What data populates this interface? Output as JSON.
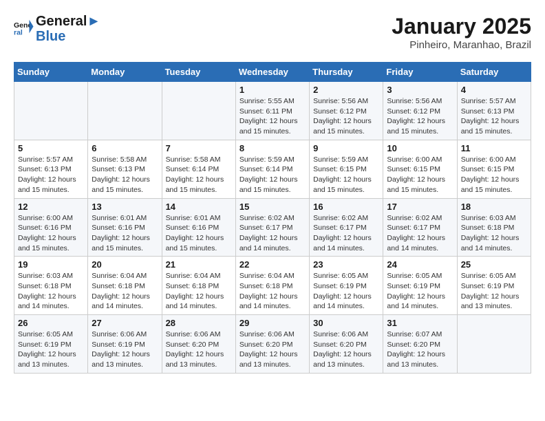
{
  "header": {
    "logo_line1": "General",
    "logo_line2": "Blue",
    "month": "January 2025",
    "location": "Pinheiro, Maranhao, Brazil"
  },
  "weekdays": [
    "Sunday",
    "Monday",
    "Tuesday",
    "Wednesday",
    "Thursday",
    "Friday",
    "Saturday"
  ],
  "weeks": [
    [
      {
        "day": "",
        "detail": ""
      },
      {
        "day": "",
        "detail": ""
      },
      {
        "day": "",
        "detail": ""
      },
      {
        "day": "1",
        "detail": "Sunrise: 5:55 AM\nSunset: 6:11 PM\nDaylight: 12 hours\nand 15 minutes."
      },
      {
        "day": "2",
        "detail": "Sunrise: 5:56 AM\nSunset: 6:12 PM\nDaylight: 12 hours\nand 15 minutes."
      },
      {
        "day": "3",
        "detail": "Sunrise: 5:56 AM\nSunset: 6:12 PM\nDaylight: 12 hours\nand 15 minutes."
      },
      {
        "day": "4",
        "detail": "Sunrise: 5:57 AM\nSunset: 6:13 PM\nDaylight: 12 hours\nand 15 minutes."
      }
    ],
    [
      {
        "day": "5",
        "detail": "Sunrise: 5:57 AM\nSunset: 6:13 PM\nDaylight: 12 hours\nand 15 minutes."
      },
      {
        "day": "6",
        "detail": "Sunrise: 5:58 AM\nSunset: 6:13 PM\nDaylight: 12 hours\nand 15 minutes."
      },
      {
        "day": "7",
        "detail": "Sunrise: 5:58 AM\nSunset: 6:14 PM\nDaylight: 12 hours\nand 15 minutes."
      },
      {
        "day": "8",
        "detail": "Sunrise: 5:59 AM\nSunset: 6:14 PM\nDaylight: 12 hours\nand 15 minutes."
      },
      {
        "day": "9",
        "detail": "Sunrise: 5:59 AM\nSunset: 6:15 PM\nDaylight: 12 hours\nand 15 minutes."
      },
      {
        "day": "10",
        "detail": "Sunrise: 6:00 AM\nSunset: 6:15 PM\nDaylight: 12 hours\nand 15 minutes."
      },
      {
        "day": "11",
        "detail": "Sunrise: 6:00 AM\nSunset: 6:15 PM\nDaylight: 12 hours\nand 15 minutes."
      }
    ],
    [
      {
        "day": "12",
        "detail": "Sunrise: 6:00 AM\nSunset: 6:16 PM\nDaylight: 12 hours\nand 15 minutes."
      },
      {
        "day": "13",
        "detail": "Sunrise: 6:01 AM\nSunset: 6:16 PM\nDaylight: 12 hours\nand 15 minutes."
      },
      {
        "day": "14",
        "detail": "Sunrise: 6:01 AM\nSunset: 6:16 PM\nDaylight: 12 hours\nand 15 minutes."
      },
      {
        "day": "15",
        "detail": "Sunrise: 6:02 AM\nSunset: 6:17 PM\nDaylight: 12 hours\nand 14 minutes."
      },
      {
        "day": "16",
        "detail": "Sunrise: 6:02 AM\nSunset: 6:17 PM\nDaylight: 12 hours\nand 14 minutes."
      },
      {
        "day": "17",
        "detail": "Sunrise: 6:02 AM\nSunset: 6:17 PM\nDaylight: 12 hours\nand 14 minutes."
      },
      {
        "day": "18",
        "detail": "Sunrise: 6:03 AM\nSunset: 6:18 PM\nDaylight: 12 hours\nand 14 minutes."
      }
    ],
    [
      {
        "day": "19",
        "detail": "Sunrise: 6:03 AM\nSunset: 6:18 PM\nDaylight: 12 hours\nand 14 minutes."
      },
      {
        "day": "20",
        "detail": "Sunrise: 6:04 AM\nSunset: 6:18 PM\nDaylight: 12 hours\nand 14 minutes."
      },
      {
        "day": "21",
        "detail": "Sunrise: 6:04 AM\nSunset: 6:18 PM\nDaylight: 12 hours\nand 14 minutes."
      },
      {
        "day": "22",
        "detail": "Sunrise: 6:04 AM\nSunset: 6:18 PM\nDaylight: 12 hours\nand 14 minutes."
      },
      {
        "day": "23",
        "detail": "Sunrise: 6:05 AM\nSunset: 6:19 PM\nDaylight: 12 hours\nand 14 minutes."
      },
      {
        "day": "24",
        "detail": "Sunrise: 6:05 AM\nSunset: 6:19 PM\nDaylight: 12 hours\nand 14 minutes."
      },
      {
        "day": "25",
        "detail": "Sunrise: 6:05 AM\nSunset: 6:19 PM\nDaylight: 12 hours\nand 13 minutes."
      }
    ],
    [
      {
        "day": "26",
        "detail": "Sunrise: 6:05 AM\nSunset: 6:19 PM\nDaylight: 12 hours\nand 13 minutes."
      },
      {
        "day": "27",
        "detail": "Sunrise: 6:06 AM\nSunset: 6:19 PM\nDaylight: 12 hours\nand 13 minutes."
      },
      {
        "day": "28",
        "detail": "Sunrise: 6:06 AM\nSunset: 6:20 PM\nDaylight: 12 hours\nand 13 minutes."
      },
      {
        "day": "29",
        "detail": "Sunrise: 6:06 AM\nSunset: 6:20 PM\nDaylight: 12 hours\nand 13 minutes."
      },
      {
        "day": "30",
        "detail": "Sunrise: 6:06 AM\nSunset: 6:20 PM\nDaylight: 12 hours\nand 13 minutes."
      },
      {
        "day": "31",
        "detail": "Sunrise: 6:07 AM\nSunset: 6:20 PM\nDaylight: 12 hours\nand 13 minutes."
      },
      {
        "day": "",
        "detail": ""
      }
    ]
  ]
}
